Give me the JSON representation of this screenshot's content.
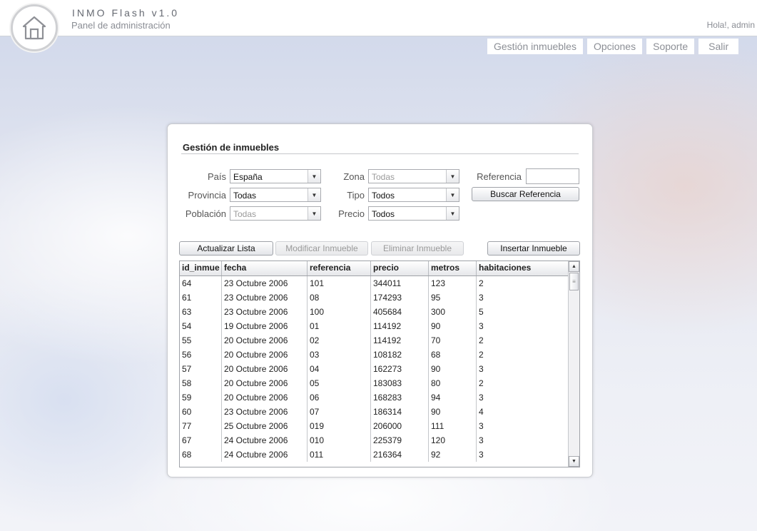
{
  "header": {
    "title": "INMO Flash v1.0",
    "subtitle": "Panel de administración",
    "greeting": "Hola!, admin"
  },
  "nav": {
    "items": [
      {
        "label": "Gestión inmuebles"
      },
      {
        "label": "Opciones"
      },
      {
        "label": "Soporte"
      },
      {
        "label": "Salir"
      }
    ]
  },
  "panel": {
    "title": "Gestión de inmuebles",
    "filters": {
      "pais_label": "País",
      "pais_value": "España",
      "provincia_label": "Provincia",
      "provincia_value": "Todas",
      "poblacion_label": "Población",
      "poblacion_value": "Todas",
      "zona_label": "Zona",
      "zona_value": "Todas",
      "tipo_label": "Tipo",
      "tipo_value": "Todos",
      "precio_label": "Precio",
      "precio_value": "Todos",
      "referencia_label": "Referencia",
      "referencia_value": "",
      "buscar_label": "Buscar Referencia"
    },
    "actions": {
      "actualizar": "Actualizar Lista",
      "modificar": "Modificar Inmueble",
      "eliminar": "Eliminar Inmueble",
      "insertar": "Insertar Inmueble"
    },
    "table": {
      "columns": [
        "id_inmue",
        "fecha",
        "referencia",
        "precio",
        "metros",
        "habitaciones"
      ],
      "rows": [
        [
          "64",
          "23 Octubre 2006",
          "101",
          "344011",
          "123",
          "2"
        ],
        [
          "61",
          "23 Octubre 2006",
          "08",
          "174293",
          "95",
          "3"
        ],
        [
          "63",
          "23 Octubre 2006",
          "100",
          "405684",
          "300",
          "5"
        ],
        [
          "54",
          "19 Octubre 2006",
          "01",
          "114192",
          "90",
          "3"
        ],
        [
          "55",
          "20 Octubre 2006",
          "02",
          "114192",
          "70",
          "2"
        ],
        [
          "56",
          "20 Octubre 2006",
          "03",
          "108182",
          "68",
          "2"
        ],
        [
          "57",
          "20 Octubre 2006",
          "04",
          "162273",
          "90",
          "3"
        ],
        [
          "58",
          "20 Octubre 2006",
          "05",
          "183083",
          "80",
          "2"
        ],
        [
          "59",
          "20 Octubre 2006",
          "06",
          "168283",
          "94",
          "3"
        ],
        [
          "60",
          "23 Octubre 2006",
          "07",
          "186314",
          "90",
          "4"
        ],
        [
          "77",
          "25 Octubre 2006",
          "019",
          "206000",
          "111",
          "3"
        ],
        [
          "67",
          "24 Octubre 2006",
          "010",
          "225379",
          "120",
          "3"
        ],
        [
          "68",
          "24 Octubre 2006",
          "011",
          "216364",
          "92",
          "3"
        ]
      ]
    }
  },
  "colors": {
    "accent_gray": "#8c8f96",
    "panel_border": "#c9cbd0"
  }
}
